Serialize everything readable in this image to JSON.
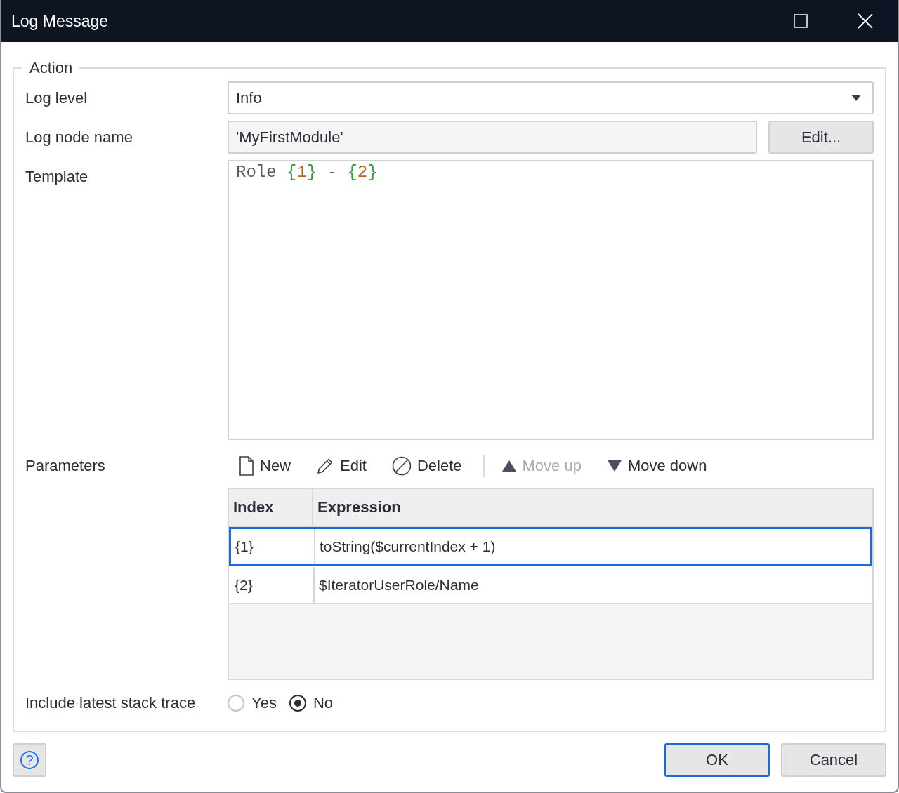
{
  "window": {
    "title": "Log Message"
  },
  "section": {
    "title": "Action"
  },
  "log_level": {
    "label": "Log level",
    "value": "Info"
  },
  "log_node_name": {
    "label": "Log node name",
    "value": "'MyFirstModule'",
    "button": "Edit..."
  },
  "template": {
    "label": "Template",
    "tokens": [
      {
        "kind": "plain",
        "text": "Role "
      },
      {
        "kind": "brace",
        "text": "{"
      },
      {
        "kind": "number",
        "text": "1"
      },
      {
        "kind": "brace",
        "text": "}"
      },
      {
        "kind": "plain",
        "text": " - "
      },
      {
        "kind": "brace",
        "text": "{"
      },
      {
        "kind": "number",
        "text": "2"
      },
      {
        "kind": "brace",
        "text": "}"
      }
    ]
  },
  "parameters": {
    "label": "Parameters",
    "toolbar": [
      {
        "kind": "new",
        "label": "New",
        "disabled": false
      },
      {
        "kind": "edit",
        "label": "Edit",
        "disabled": false
      },
      {
        "kind": "delete",
        "label": "Delete",
        "disabled": false
      },
      {
        "kind": "up",
        "label": "Move up",
        "disabled": true
      },
      {
        "kind": "down",
        "label": "Move down",
        "disabled": false
      }
    ],
    "columns": [
      "Index",
      "Expression"
    ],
    "rows": [
      {
        "cells": [
          "{1}",
          "toString($currentIndex + 1)"
        ],
        "selected": true
      },
      {
        "cells": [
          "{2}",
          "$IteratorUserRole/Name"
        ],
        "selected": false
      }
    ]
  },
  "stack_trace": {
    "label": "Include latest stack trace",
    "options": [
      {
        "label": "Yes",
        "selected": false
      },
      {
        "label": "No",
        "selected": true
      }
    ]
  },
  "help_button": {
    "label": "?"
  },
  "buttons": [
    {
      "label": "OK",
      "default": true
    },
    {
      "label": "Cancel",
      "default": false
    }
  ]
}
